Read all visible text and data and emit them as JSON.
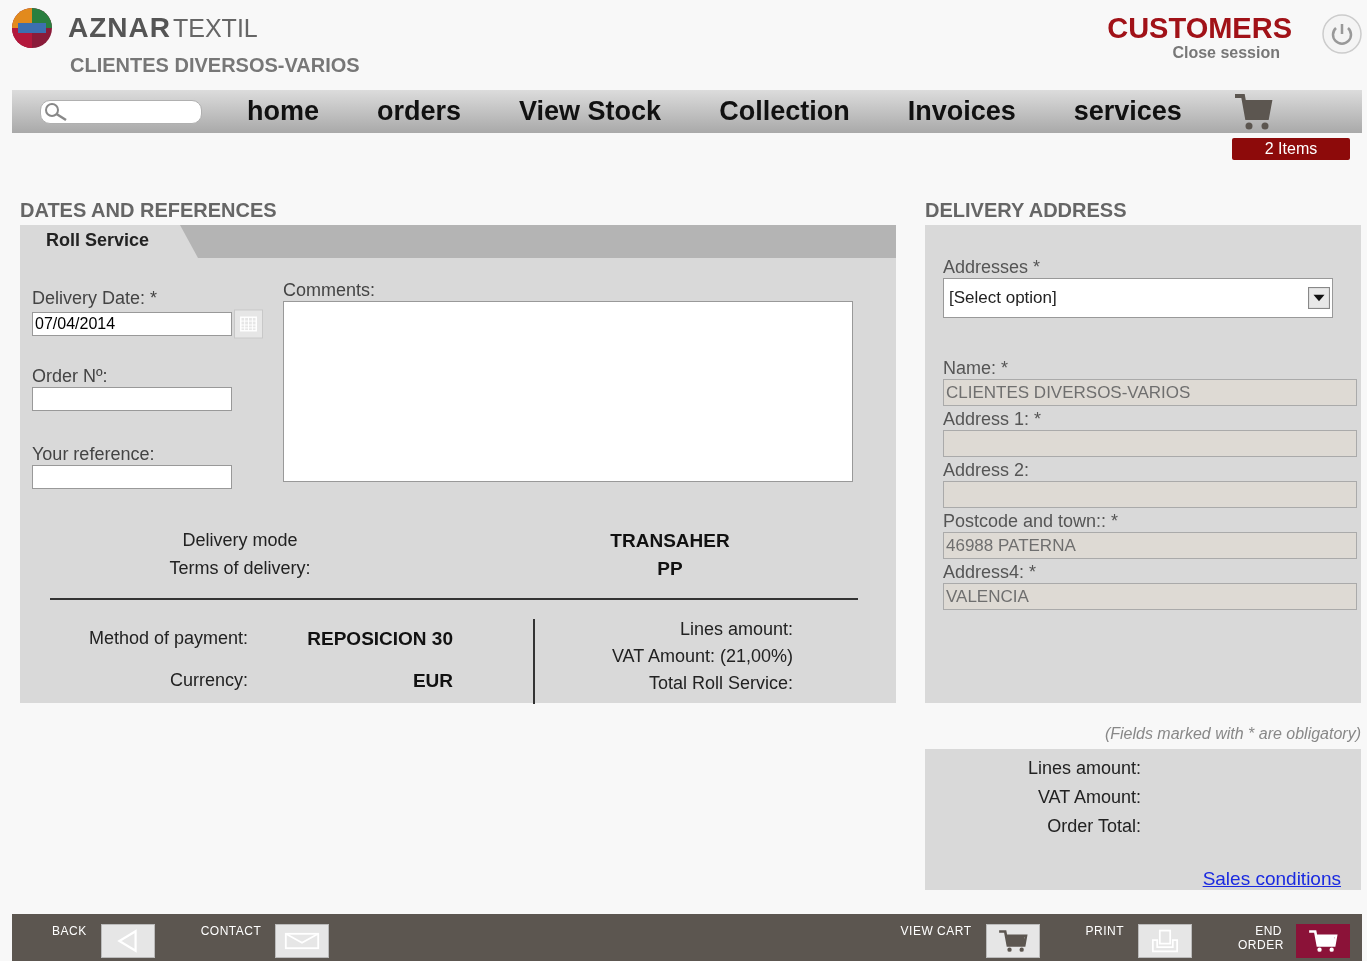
{
  "header": {
    "brand_bold": "AZNAR",
    "brand_light": "TEXTIL",
    "customer": "CLIENTES DIVERSOS-VARIOS",
    "section": "CUSTOMERS",
    "close_session": "Close session"
  },
  "nav": {
    "items": [
      "home",
      "orders",
      "View Stock",
      "Collection",
      "Invoices",
      "services"
    ],
    "cart_badge": "2 Items"
  },
  "dates": {
    "title": "DATES AND REFERENCES",
    "tab": "Roll Service",
    "fields": [
      {
        "label": "Delivery Date: *",
        "value": "07/04/2014",
        "kind": "date"
      },
      {
        "label": "Order Nº:",
        "kind": "text"
      },
      {
        "label": "Your reference:",
        "kind": "text"
      }
    ],
    "comments_label": "Comments:",
    "delivery": [
      {
        "label": "Delivery mode",
        "value": "TRANSAHER"
      },
      {
        "label": "Terms of delivery:",
        "value": "PP"
      }
    ],
    "payment": [
      {
        "label": "Method of payment:",
        "value": "REPOSICION 30"
      },
      {
        "label": "Currency:",
        "value": "EUR"
      }
    ],
    "totals": [
      "Lines amount:",
      "VAT Amount: (21,00%)",
      "Total Roll Service:"
    ]
  },
  "address": {
    "title": "DELIVERY ADDRESS",
    "select": {
      "label": "Addresses *",
      "value": "[Select option]"
    },
    "fields": [
      {
        "label": "Name: *",
        "value": "CLIENTES DIVERSOS-VARIOS"
      },
      {
        "label": "Address 1: *"
      },
      {
        "label": "Address 2:"
      },
      {
        "label": "Postcode and town:: *",
        "value": "46988 PATERNA"
      },
      {
        "label": "Address4: *",
        "value": "VALENCIA"
      }
    ]
  },
  "note": "(Fields marked with * are obligatory)",
  "summary": {
    "lines": [
      "Lines amount:",
      "VAT Amount:",
      "Order Total:"
    ],
    "link": "Sales conditions"
  },
  "footer": [
    {
      "label": "BACK",
      "kind": "back"
    },
    {
      "label": "CONTACT",
      "kind": "contact"
    },
    {
      "label": "VIEW CART",
      "kind": "cart"
    },
    {
      "label": "PRINT",
      "kind": "print"
    },
    {
      "label": "END ORDER",
      "kind": "end"
    }
  ]
}
